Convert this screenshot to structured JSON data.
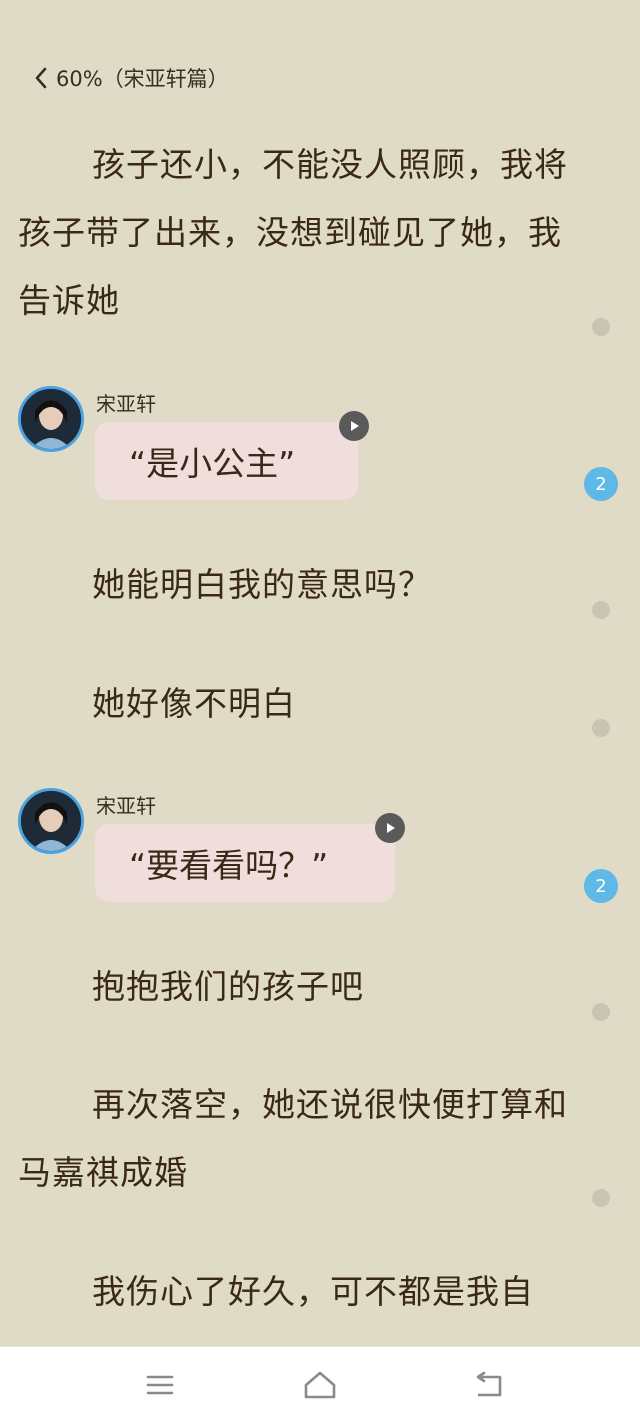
{
  "header": {
    "title": "60%（宋亚轩篇）",
    "back_icon": "chevron-left-icon"
  },
  "story": {
    "paragraph_1": "孩子还小，不能没人照顾，我将孩子带了出来，没想到碰见了她，我告诉她",
    "dialogue_1": {
      "speaker": "宋亚轩",
      "text": "“是小公主”",
      "comment_count": "2"
    },
    "paragraph_2": "她能明白我的意思吗？",
    "paragraph_3": "她好像不明白",
    "dialogue_2": {
      "speaker": "宋亚轩",
      "text": "“要看看吗？”",
      "comment_count": "2"
    },
    "paragraph_4": "抱抱我们的孩子吧",
    "paragraph_5": "再次落空，她还说很快便打算和马嘉祺成婚",
    "paragraph_6": "我伤心了好久，可不都是我自"
  },
  "colors": {
    "background": "#e0dbc6",
    "bubble": "#f0dedd",
    "badge": "#5fb9e6",
    "avatar_border": "#4aa3e0"
  },
  "navbar": {
    "menu_icon": "menu-icon",
    "home_icon": "home-icon",
    "back_icon": "back-arrow-icon"
  }
}
